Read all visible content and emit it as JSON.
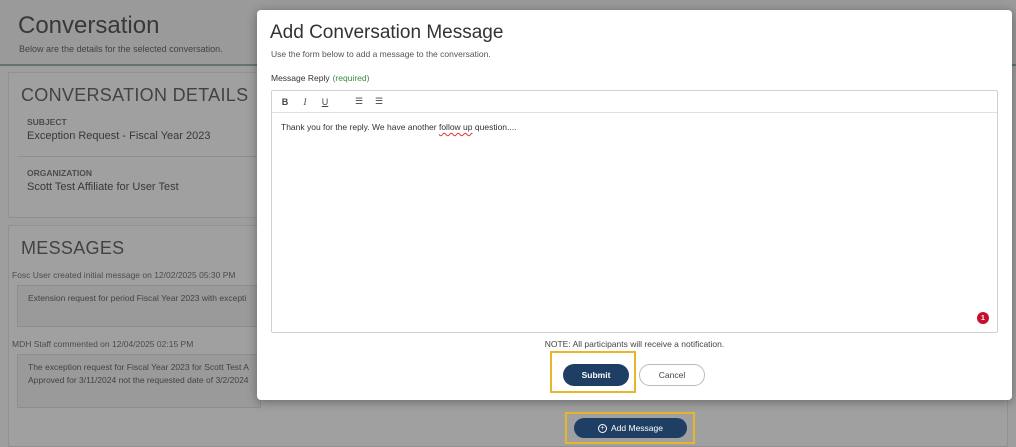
{
  "page": {
    "title": "Conversation",
    "subtitle": "Below are the details for the selected conversation."
  },
  "details": {
    "heading": "CONVERSATION DETAILS",
    "subject_label": "SUBJECT",
    "subject_value": "Exception Request - Fiscal Year 2023",
    "organization_label": "ORGANIZATION",
    "organization_value": "Scott Test Affiliate for User Test"
  },
  "messages": {
    "heading": "MESSAGES",
    "items": [
      {
        "meta": "Fosc User created initial message on 12/02/2025 05:30 PM",
        "text_line1": "Extension request for period Fiscal Year 2023 with excepti",
        "text_line2": ""
      },
      {
        "meta": "MDH Staff commented on 12/04/2025 02:15 PM",
        "text_line1": "The exception request for Fiscal Year 2023 for Scott Test A",
        "text_line2": "Approved for 3/11/2024 not the requested date of 3/2/2024"
      }
    ],
    "add_button_label": "Add Message"
  },
  "modal": {
    "title": "Add Conversation Message",
    "subtitle": "Use the form below to add a message to the conversation.",
    "field_label": "Message Reply",
    "required_label": "(required)",
    "toolbar": {
      "bold": "B",
      "italic": "I",
      "underline": "U",
      "bullet_list": "☰",
      "numbered_list": "☰"
    },
    "editor_text_before": "Thank you for the reply.  We have another ",
    "editor_text_misspelled": "follow up",
    "editor_text_after": " question....",
    "badge_count": "1",
    "note": "NOTE: All participants will receive a notification.",
    "submit_label": "Submit",
    "cancel_label": "Cancel"
  },
  "colors": {
    "primary": "#1f3e63",
    "highlight": "#e8b62a",
    "required": "#3a8a3a",
    "badge": "#c8102e"
  }
}
